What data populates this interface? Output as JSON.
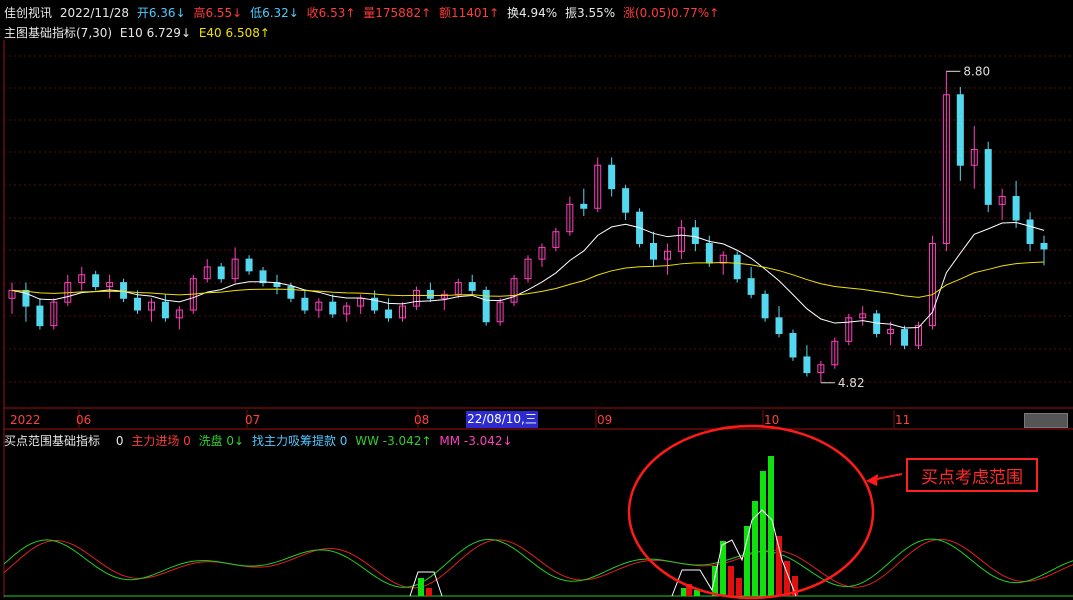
{
  "header": {
    "name": "佳创视讯",
    "date": "2022/11/28",
    "open": "开6.36↓",
    "high": "高6.55↓",
    "low": "低6.32↓",
    "close": "收6.53↑",
    "volume": "量175882↑",
    "amount": "额11401↑",
    "turnover": "换4.94%",
    "amplitude": "振3.55%",
    "change": "涨(0.05)0.77%↑"
  },
  "main_indicator": {
    "title": "主图基础指标(7,30)",
    "e10": "E10 6.729↓",
    "e40": "E40 6.508↑"
  },
  "timeline": {
    "months": [
      "2022",
      "06",
      "07",
      "08",
      "09",
      "10",
      "11"
    ],
    "cursor_date": "22/08/10,三"
  },
  "sub_indicator": {
    "title": "买点范围基础指标",
    "v0": "0",
    "zl": "主力进场 0",
    "xp": "洗盘 0↓",
    "zlxc": "找主力吸筹提款 0",
    "ww": "WW -3.042↑",
    "mm": "MM -3.042↓"
  },
  "annotation": {
    "label": "买点考虑范围"
  },
  "chart_data": {
    "type": "candlestick",
    "high_label": "8.80",
    "low_label": "4.82",
    "y_range": [
      4.6,
      9.2
    ],
    "candles": [
      [
        5.9,
        6.1,
        5.7,
        6.0
      ],
      [
        6.0,
        6.1,
        5.6,
        5.8
      ],
      [
        5.8,
        5.9,
        5.5,
        5.55
      ],
      [
        5.55,
        5.9,
        5.5,
        5.85
      ],
      [
        5.85,
        6.2,
        5.8,
        6.1
      ],
      [
        6.1,
        6.3,
        6.0,
        6.2
      ],
      [
        6.2,
        6.25,
        6.0,
        6.05
      ],
      [
        6.05,
        6.2,
        5.9,
        6.1
      ],
      [
        6.1,
        6.15,
        5.85,
        5.9
      ],
      [
        5.9,
        6.0,
        5.7,
        5.75
      ],
      [
        5.75,
        5.9,
        5.6,
        5.85
      ],
      [
        5.85,
        5.95,
        5.6,
        5.65
      ],
      [
        5.65,
        5.8,
        5.5,
        5.75
      ],
      [
        5.75,
        6.2,
        5.7,
        6.15
      ],
      [
        6.15,
        6.4,
        6.1,
        6.3
      ],
      [
        6.3,
        6.35,
        6.1,
        6.15
      ],
      [
        6.15,
        6.55,
        6.1,
        6.4
      ],
      [
        6.4,
        6.45,
        6.2,
        6.25
      ],
      [
        6.25,
        6.3,
        6.05,
        6.1
      ],
      [
        6.1,
        6.2,
        5.95,
        6.05
      ],
      [
        6.05,
        6.1,
        5.85,
        5.9
      ],
      [
        5.9,
        6.0,
        5.7,
        5.75
      ],
      [
        5.75,
        5.9,
        5.65,
        5.85
      ],
      [
        5.85,
        5.95,
        5.65,
        5.7
      ],
      [
        5.7,
        5.85,
        5.6,
        5.8
      ],
      [
        5.8,
        5.95,
        5.7,
        5.9
      ],
      [
        5.9,
        6.0,
        5.7,
        5.75
      ],
      [
        5.75,
        5.9,
        5.6,
        5.65
      ],
      [
        5.65,
        5.85,
        5.6,
        5.8
      ],
      [
        5.8,
        6.05,
        5.75,
        6.0
      ],
      [
        6.0,
        6.1,
        5.85,
        5.9
      ],
      [
        5.9,
        6.0,
        5.75,
        5.95
      ],
      [
        5.95,
        6.15,
        5.9,
        6.1
      ],
      [
        6.1,
        6.2,
        5.95,
        6.0
      ],
      [
        6.0,
        6.05,
        5.55,
        5.6
      ],
      [
        5.6,
        5.9,
        5.55,
        5.85
      ],
      [
        5.85,
        6.2,
        5.8,
        6.15
      ],
      [
        6.15,
        6.45,
        6.1,
        6.4
      ],
      [
        6.4,
        6.6,
        6.3,
        6.55
      ],
      [
        6.55,
        6.8,
        6.5,
        6.75
      ],
      [
        6.75,
        7.2,
        6.7,
        7.1
      ],
      [
        7.1,
        7.3,
        6.95,
        7.05
      ],
      [
        7.05,
        7.7,
        7.0,
        7.6
      ],
      [
        7.6,
        7.7,
        7.2,
        7.3
      ],
      [
        7.3,
        7.35,
        6.9,
        7.0
      ],
      [
        7.0,
        7.05,
        6.55,
        6.6
      ],
      [
        6.6,
        6.75,
        6.3,
        6.4
      ],
      [
        6.4,
        6.6,
        6.2,
        6.5
      ],
      [
        6.5,
        6.9,
        6.4,
        6.8
      ],
      [
        6.8,
        6.9,
        6.5,
        6.6
      ],
      [
        6.6,
        6.7,
        6.3,
        6.35
      ],
      [
        6.35,
        6.5,
        6.2,
        6.45
      ],
      [
        6.45,
        6.5,
        6.1,
        6.15
      ],
      [
        6.15,
        6.3,
        5.9,
        5.95
      ],
      [
        5.95,
        6.0,
        5.6,
        5.65
      ],
      [
        5.65,
        5.8,
        5.4,
        5.45
      ],
      [
        5.45,
        5.5,
        5.1,
        5.15
      ],
      [
        5.15,
        5.3,
        4.9,
        4.95
      ],
      [
        4.95,
        5.1,
        4.82,
        5.05
      ],
      [
        5.05,
        5.4,
        5.0,
        5.35
      ],
      [
        5.35,
        5.7,
        5.3,
        5.65
      ],
      [
        5.65,
        5.8,
        5.55,
        5.7
      ],
      [
        5.7,
        5.75,
        5.4,
        5.45
      ],
      [
        5.45,
        5.6,
        5.3,
        5.5
      ],
      [
        5.5,
        5.55,
        5.25,
        5.3
      ],
      [
        5.3,
        5.6,
        5.25,
        5.55
      ],
      [
        5.55,
        6.7,
        5.5,
        6.6
      ],
      [
        6.6,
        8.8,
        6.5,
        8.5
      ],
      [
        8.5,
        8.6,
        7.4,
        7.6
      ],
      [
        7.6,
        8.1,
        7.3,
        7.8
      ],
      [
        7.8,
        7.9,
        7.0,
        7.1
      ],
      [
        7.1,
        7.3,
        6.9,
        7.2
      ],
      [
        7.2,
        7.4,
        6.8,
        6.9
      ],
      [
        6.9,
        7.0,
        6.5,
        6.6
      ],
      [
        6.6,
        6.7,
        6.32,
        6.53
      ]
    ],
    "e10_label": "E10",
    "e40_label": "E40"
  }
}
